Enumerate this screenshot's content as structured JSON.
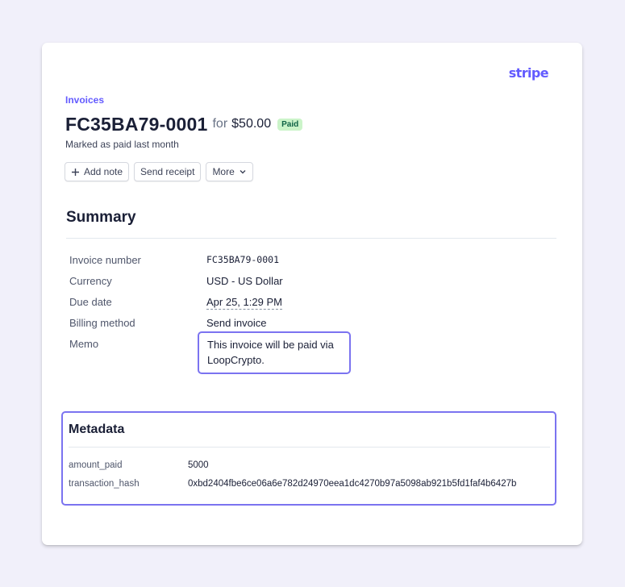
{
  "brand": {
    "logo_text": "stripe",
    "accent_color": "#635bff"
  },
  "breadcrumb": "Invoices",
  "header": {
    "invoice_number": "FC35BA79-0001",
    "for_text": "for",
    "amount": "$50.00",
    "status_badge": "Paid",
    "status_color": "#cbf4c9",
    "subtitle_prefix": "Marked as paid",
    "subtitle_time": "last month"
  },
  "actions": {
    "add_note": "Add note",
    "send_receipt": "Send receipt",
    "more": "More"
  },
  "summary": {
    "title": "Summary",
    "rows": [
      {
        "label": "Invoice number",
        "value": "FC35BA79-0001"
      },
      {
        "label": "Currency",
        "value": "USD - US Dollar"
      },
      {
        "label": "Due date",
        "value": "Apr 25, 1:29 PM"
      },
      {
        "label": "Billing method",
        "value": "Send invoice"
      },
      {
        "label": "Memo",
        "value": "This invoice will be paid via LoopCrypto."
      }
    ]
  },
  "metadata": {
    "title": "Metadata",
    "rows": [
      {
        "key": "amount_paid",
        "value": "5000"
      },
      {
        "key": "transaction_hash",
        "value": "0xbd2404fbe6ce06a6e782d24970eea1dc4270b97a5098ab921b5fd1faf4b6427b"
      }
    ]
  }
}
